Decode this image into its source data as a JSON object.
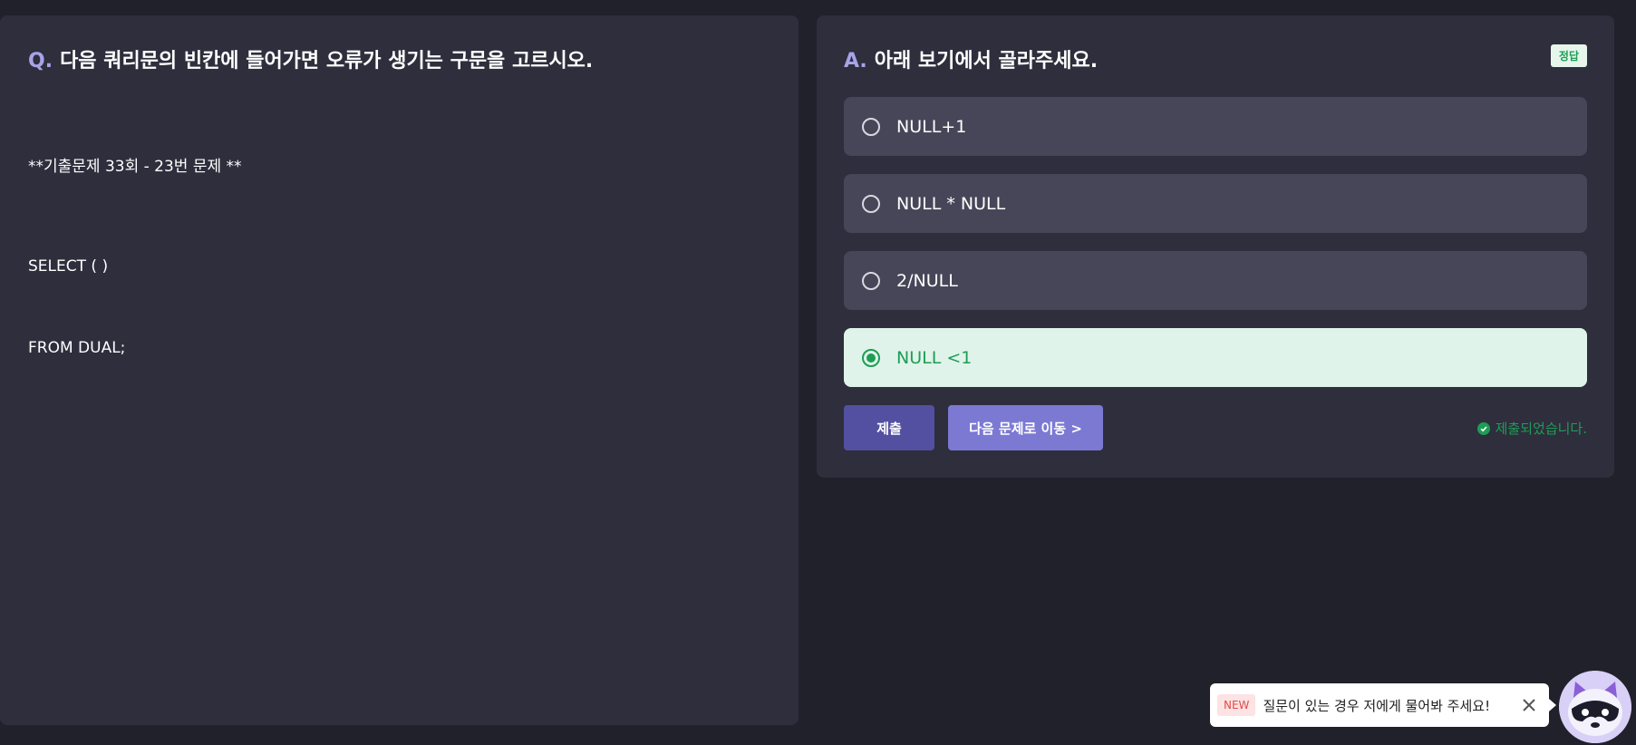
{
  "question": {
    "prefix": "Q.",
    "title": "다음 쿼리문의 빈칸에 들어가면 오류가 생기는 구문을 고르시오.",
    "subtitle": "**기출문제 33회 - 23번 문제 **",
    "code_line1": "SELECT ( )",
    "code_line2": "FROM DUAL;"
  },
  "answer": {
    "prefix": "A.",
    "title": "아래 보기에서 골라주세요.",
    "correct_badge": "정답",
    "options": [
      {
        "label": "NULL+1",
        "selected": false
      },
      {
        "label": "NULL * NULL",
        "selected": false
      },
      {
        "label": "2/NULL",
        "selected": false
      },
      {
        "label": "NULL <1",
        "selected": true
      }
    ],
    "submit_label": "제출",
    "next_label": "다음 문제로 이동 >",
    "status_text": "제출되었습니다."
  },
  "chat": {
    "badge": "NEW",
    "message": "질문이 있는 경우 저에게 물어봐 주세요!"
  },
  "icons": {
    "close": "close-icon",
    "check": "check-circle-icon",
    "mascot": "raccoon-mascot-icon"
  },
  "colors": {
    "accent": "#a7a3e8",
    "success": "#1e9d55",
    "submit": "#5350a1",
    "next": "#7c79d3"
  }
}
